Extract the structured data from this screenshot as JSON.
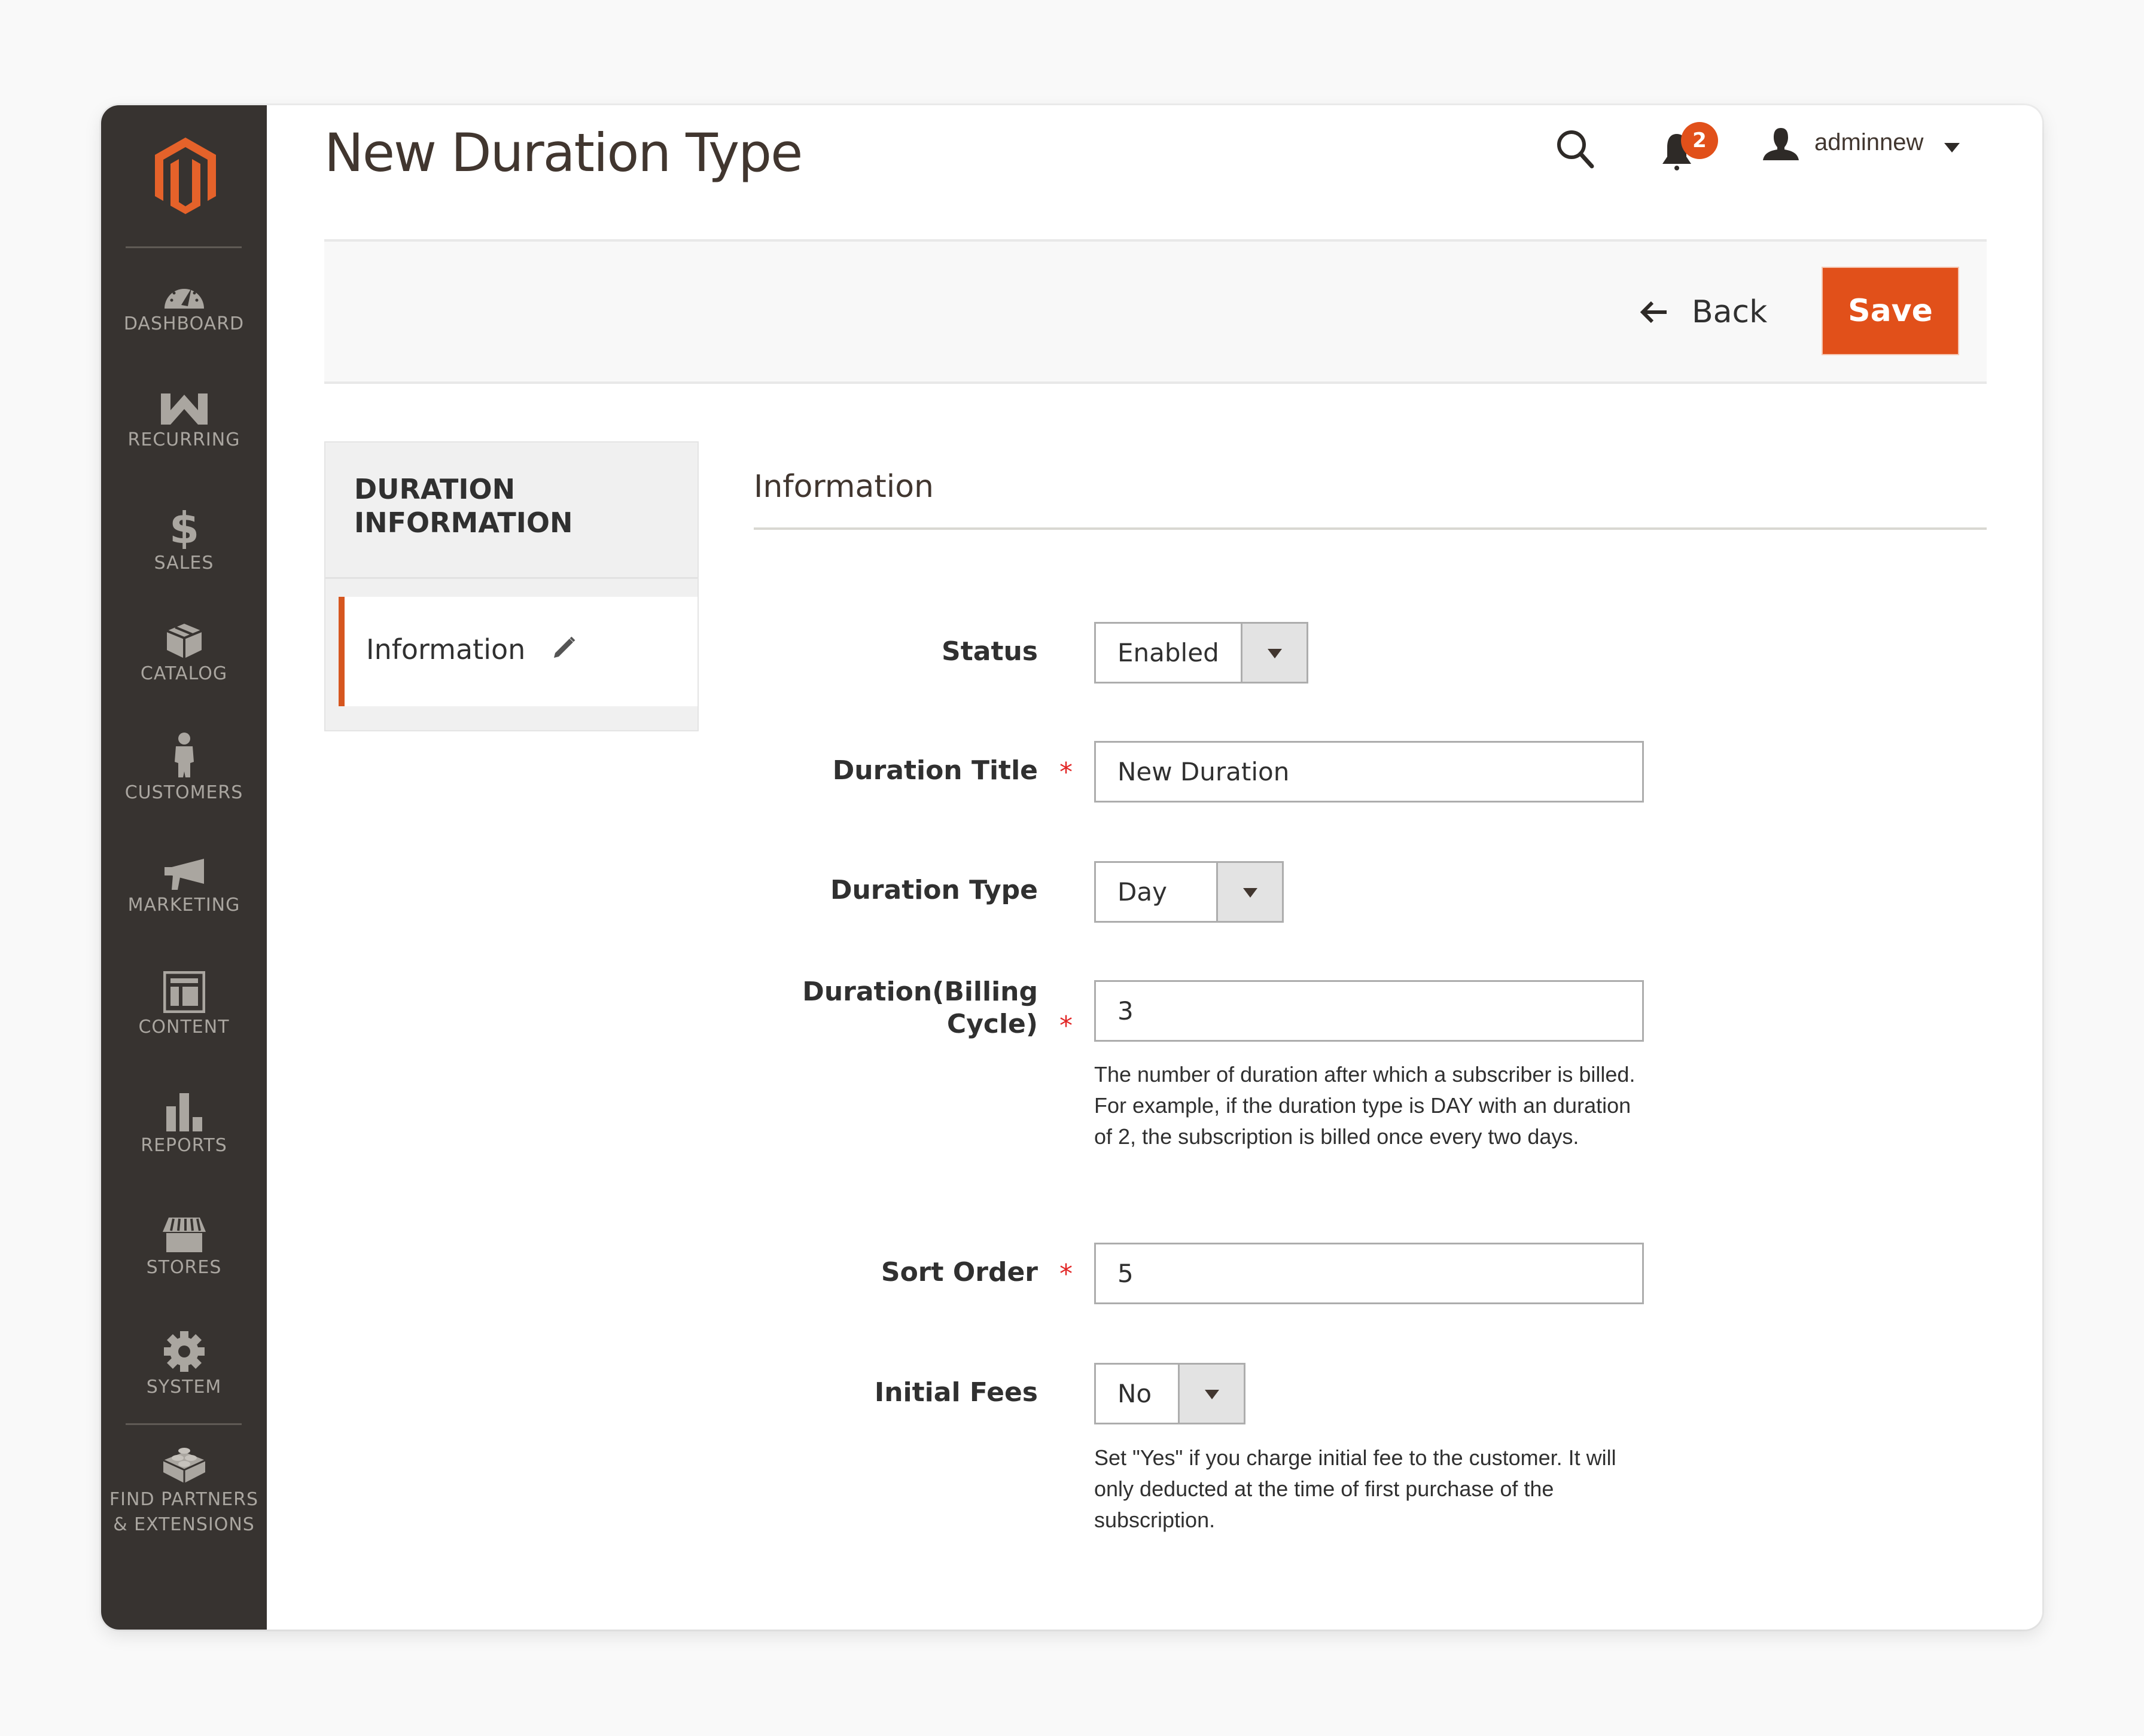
{
  "window": {
    "title": "New Duration Type"
  },
  "sidebar": {
    "logo": "magento-logo",
    "items": [
      {
        "label": "DASHBOARD",
        "icon": "dashboard-gauge-icon"
      },
      {
        "label": "RECURRING",
        "icon": "recurring-w-icon"
      },
      {
        "label": "SALES",
        "icon": "dollar-icon"
      },
      {
        "label": "CATALOG",
        "icon": "box-icon"
      },
      {
        "label": "CUSTOMERS",
        "icon": "person-icon"
      },
      {
        "label": "MARKETING",
        "icon": "megaphone-icon"
      },
      {
        "label": "CONTENT",
        "icon": "layout-icon"
      },
      {
        "label": "REPORTS",
        "icon": "bar-chart-icon"
      },
      {
        "label": "STORES",
        "icon": "storefront-icon"
      },
      {
        "label": "SYSTEM",
        "icon": "gear-icon"
      }
    ],
    "extensions": {
      "label_line1": "FIND PARTNERS",
      "label_line2": "& EXTENSIONS",
      "icon": "lego-block-icon"
    }
  },
  "header": {
    "search_icon": "search-icon",
    "notifications": {
      "icon": "bell-icon",
      "count": "2"
    },
    "user": {
      "icon": "user-icon",
      "name": "adminnew",
      "caret": "caret-down-icon"
    }
  },
  "actions": {
    "back_label": "Back",
    "save_label": "Save"
  },
  "tabs": {
    "title": "DURATION INFORMATION",
    "items": [
      {
        "label": "Information",
        "active": true,
        "icon": "pencil-icon"
      }
    ]
  },
  "form": {
    "section_title": "Information",
    "fields": {
      "status": {
        "label": "Status",
        "value": "Enabled",
        "required": false
      },
      "duration_title": {
        "label": "Duration Title",
        "value": "New Duration",
        "required": true
      },
      "duration_type": {
        "label": "Duration Type",
        "value": "Day",
        "required": false
      },
      "billing_cycle": {
        "label_line1": "Duration(Billing",
        "label_line2": "Cycle)",
        "value": "3",
        "required": true,
        "note": "The number of duration after which a subscriber is billed. For example, if the duration type is DAY with an duration of 2, the subscription is billed once every two days."
      },
      "sort_order": {
        "label": "Sort Order",
        "value": "5",
        "required": true
      },
      "initial_fees": {
        "label": "Initial Fees",
        "value": "No",
        "required": false,
        "note": "Set \"Yes\" if you charge initial fee to the customer. It will only deducted at the time of first purchase of the subscription."
      }
    },
    "required_marker": "*"
  },
  "colors": {
    "accent": "#e1501a",
    "sidebar_bg": "#373330",
    "sidebar_text": "#aaa6a0",
    "required": "#e22626"
  }
}
